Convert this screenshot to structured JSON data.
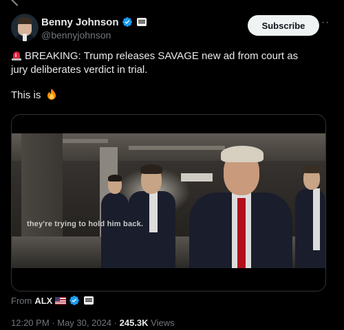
{
  "tweet": {
    "display_name": "Benny Johnson",
    "handle": "@bennyjohnson",
    "subscribe_label": "Subscribe",
    "more_label": "···",
    "text_line1": "BREAKING: Trump releases SAVAGE new ad from court as",
    "text_line2": "jury deliberates verdict in trial.",
    "text_line3": "This is",
    "video_caption": "they're trying to hold him back.",
    "from_label": "From",
    "from_source": "ALX",
    "time": "12:20 PM",
    "date": "May 30, 2024",
    "views_count": "245.3K",
    "views_label": "Views",
    "separator": "·"
  },
  "icons": {
    "verified": "verified-badge-icon",
    "siren": "rotating-light-emoji",
    "fire": "fire-emoji",
    "flag": "us-flag-emoji"
  },
  "colors": {
    "background": "#000000",
    "text": "#e7e9ea",
    "muted": "#71767b",
    "verified_blue": "#1d9bf0",
    "subscribe_bg": "#eff3f4"
  }
}
